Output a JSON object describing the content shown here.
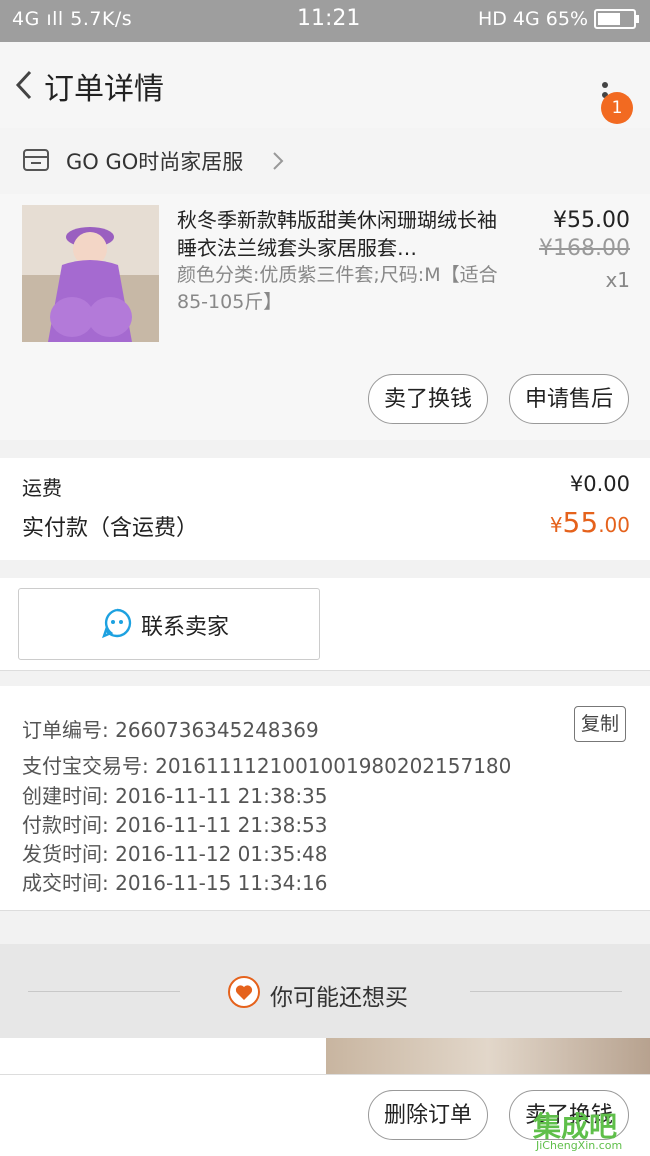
{
  "status_bar": {
    "left": "4G ıll  5.7K/s",
    "time": "11:21",
    "right": "HD 4G 65%",
    "battery_percent": 65
  },
  "header": {
    "title": "订单详情",
    "badge": "1",
    "back_icon": "chevron-left-icon",
    "more_icon": "more-vertical-icon"
  },
  "shop": {
    "name": "GO GO时尚家居服",
    "icon": "store-icon"
  },
  "product": {
    "name": "秋冬季新款韩版甜美休闲珊瑚绒长袖睡衣法兰绒套头家居服套…",
    "spec": "颜色分类:优质紫三件套;尺码:M【适合85-105斤】",
    "price": "¥55.00",
    "original_price": "¥168.00",
    "quantity": "x1",
    "buttons": {
      "sell": "卖了换钱",
      "after_sale": "申请售后"
    }
  },
  "totals": {
    "shipping_label": "运费",
    "shipping_value": "¥0.00",
    "paid_label": "实付款（含运费）",
    "paid_symbol": "¥",
    "paid_int": "55",
    "paid_dec": ".00",
    "accent": "#e5621c"
  },
  "contact": {
    "label": "联系卖家",
    "icon": "chat-bubble-icon"
  },
  "order_info": {
    "order_no": "订单编号: 2660736345248369",
    "copy_label": "复制",
    "alipay_no": "支付宝交易号: 2016111121001001980202157180",
    "created": "创建时间: 2016-11-11 21:38:35",
    "paid": "付款时间: 2016-11-11 21:38:53",
    "shipped": "发货时间: 2016-11-12 01:35:48",
    "completed": "成交时间: 2016-11-15 11:34:16"
  },
  "recommend": {
    "label": "你可能还想买",
    "icon": "heart-icon"
  },
  "bottom_bar": {
    "delete": "删除订单",
    "sell": "卖了换钱"
  },
  "watermark": {
    "text": "集成吧",
    "url": "JiChengXin.com"
  }
}
